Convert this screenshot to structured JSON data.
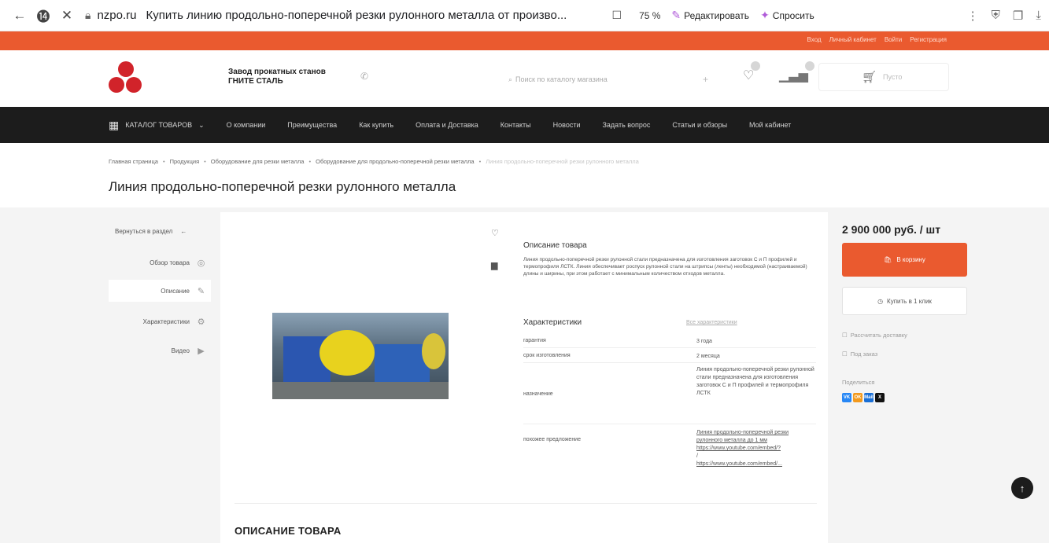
{
  "browser": {
    "domain": "nzpo.ru",
    "tab_title": "Купить линию продольно-поперечной резки рулонного металла от произво...",
    "zoom": "75 %",
    "edit_label": "Редактировать",
    "ask_label": "Спросить"
  },
  "topstrip": {
    "links": [
      "Вход",
      "Личный кабинет",
      "Войти",
      "Регистрация"
    ]
  },
  "header": {
    "brand": "Завод прокатных станов ГНИТЕ СТАЛЬ",
    "search_placeholder": "Поиск по каталогу магазина",
    "cart_label": "Пусто"
  },
  "nav": {
    "catalog": "КАТАЛОГ ТОВАРОВ",
    "items": [
      "О компании",
      "Преимущества",
      "Как купить",
      "Оплата и Доставка",
      "Контакты",
      "Новости",
      "Задать вопрос",
      "Статьи и обзоры",
      "Мой кабинет"
    ]
  },
  "breadcrumbs": [
    "Главная страница",
    "Продукция",
    "Оборудование для резки металла",
    "Оборудование для продольно-поперечной резки металла",
    "Линия продольно-поперечной резки рулонного металла"
  ],
  "page_title": "Линия продольно-поперечной резки рулонного металла",
  "sidenav": {
    "back": "Вернуться в раздел",
    "items": [
      "Обзор товара",
      "Описание",
      "Характеристики",
      "Видео"
    ]
  },
  "product": {
    "desc_heading": "Описание товара",
    "desc_text": "Линия продольно-поперечной резки рулонной стали предназначена для изготовления заготовок С и П профилей и термопрофиля ЛСТК. Линия обеспечивает роспуск рулонной стали на штрипсы (ленты) необходимой (настраиваемой) длины и ширины, при этом работает с минимальным количеством отходов металла.",
    "char_heading": "Характеристики",
    "char_all": "Все характеристики",
    "chars": [
      {
        "key": "гарантия",
        "value": "3 года"
      },
      {
        "key": "срок изготовления",
        "value": "2 месяца"
      },
      {
        "key": "назначение",
        "value": "Линия продольно-поперечной резки рулонной стали предназначена для изготовления заготовок С и П профилей и термопрофиля ЛСТК"
      },
      {
        "key": "похожее предложение",
        "links": [
          "Линия продольно-поперечной резки рулонного металла до 1 мм",
          "https://www.youtube.com/embed/?",
          "/",
          "https://www.youtube.com/embed/..."
        ]
      }
    ],
    "section_title": "ОПИСАНИЕ ТОВАРА"
  },
  "buy": {
    "price": "2 900 000 руб. / шт",
    "cart_button": "В корзину",
    "one_click": "Купить в 1 клик",
    "delivery": "Рассчитать доставку",
    "order": "Под заказ",
    "share": "Поделиться",
    "socials": [
      "VK",
      "OK",
      "Mail",
      "X"
    ]
  },
  "colors": {
    "accent": "#ea5a2f",
    "nav_bg": "#1c1c1c",
    "logo": "#d1232a"
  }
}
